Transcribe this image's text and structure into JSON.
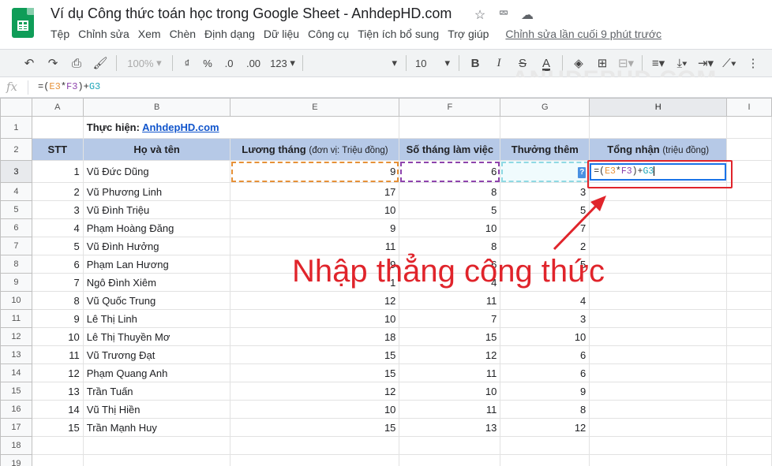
{
  "app": {
    "title": "Ví dụ Công thức toán học trong Google Sheet - AnhdepHD.com",
    "menu": [
      "Tệp",
      "Chỉnh sửa",
      "Xem",
      "Chèn",
      "Định dạng",
      "Dữ liệu",
      "Công cụ",
      "Tiện ích bổ sung",
      "Trợ giúp"
    ],
    "last_edit": "Chỉnh sửa lần cuối 9 phút trước"
  },
  "toolbar": {
    "zoom": "100%",
    "currency": "₫",
    "percent": "%",
    "decimal_dec": ".0",
    "decimal_inc": ".00",
    "format_more": "123",
    "font_size": "10"
  },
  "watermark": "ANHDEPHD.COM",
  "formula_bar": {
    "fx_label": "fx",
    "open": "=(",
    "e3": "E3",
    "mult": "*",
    "f3": "F3",
    "close_plus": ")+",
    "g3": "G3"
  },
  "columns": [
    "A",
    "B",
    "E",
    "F",
    "G",
    "H",
    "I"
  ],
  "credit": {
    "label": "Thực hiện: ",
    "link": "AnhdepHD.com"
  },
  "table_headers": {
    "stt": "STT",
    "name": "Họ và tên",
    "salary": "Lương tháng",
    "salary_unit": "(đơn vị: Triệu đồng)",
    "months": "Số tháng làm việc",
    "bonus": "Thưởng thêm",
    "total": "Tổng nhận",
    "total_unit": "(triệu đồng)"
  },
  "rows": [
    {
      "stt": "1",
      "name": "Vũ Đức Dũng",
      "salary": "9",
      "months": "6",
      "bonus": ""
    },
    {
      "stt": "2",
      "name": "Vũ Phương Linh",
      "salary": "17",
      "months": "8",
      "bonus": "3"
    },
    {
      "stt": "3",
      "name": "Vũ Đình Triệu",
      "salary": "10",
      "months": "5",
      "bonus": "5"
    },
    {
      "stt": "4",
      "name": "Phạm Hoàng Đăng",
      "salary": "9",
      "months": "10",
      "bonus": "7"
    },
    {
      "stt": "5",
      "name": "Vũ Đình Hưởng",
      "salary": "11",
      "months": "8",
      "bonus": "2"
    },
    {
      "stt": "6",
      "name": "Phạm Lan Hương",
      "salary": "9",
      "months": "6",
      "bonus": "5"
    },
    {
      "stt": "7",
      "name": "Ngô Đình Xiêm",
      "salary": "1",
      "months": "4",
      "bonus": ""
    },
    {
      "stt": "8",
      "name": "Vũ Quốc Trung",
      "salary": "12",
      "months": "11",
      "bonus": "4"
    },
    {
      "stt": "9",
      "name": "Lê Thị Linh",
      "salary": "10",
      "months": "7",
      "bonus": "3"
    },
    {
      "stt": "10",
      "name": "Lê Thị Thuyền Mơ",
      "salary": "18",
      "months": "15",
      "bonus": "10"
    },
    {
      "stt": "11",
      "name": "Vũ Trương Đạt",
      "salary": "15",
      "months": "12",
      "bonus": "6"
    },
    {
      "stt": "12",
      "name": "Phạm Quang Anh",
      "salary": "15",
      "months": "11",
      "bonus": "6"
    },
    {
      "stt": "13",
      "name": "Trần Tuấn",
      "salary": "12",
      "months": "10",
      "bonus": "9"
    },
    {
      "stt": "14",
      "name": "Vũ Thị Hiền",
      "salary": "10",
      "months": "11",
      "bonus": "8"
    },
    {
      "stt": "15",
      "name": "Trần Mạnh Huy",
      "salary": "15",
      "months": "13",
      "bonus": "12"
    }
  ],
  "g3_tooltip": "?",
  "annotation": "Nhập thẳng công thức",
  "colors": {
    "header_fill": "#b6c9e7",
    "total_header": "#d42a2a",
    "annotation": "#e0242b",
    "ref_e3": "#e69138",
    "ref_f3": "#8e44ad",
    "ref_g3": "#1aa4b8"
  }
}
